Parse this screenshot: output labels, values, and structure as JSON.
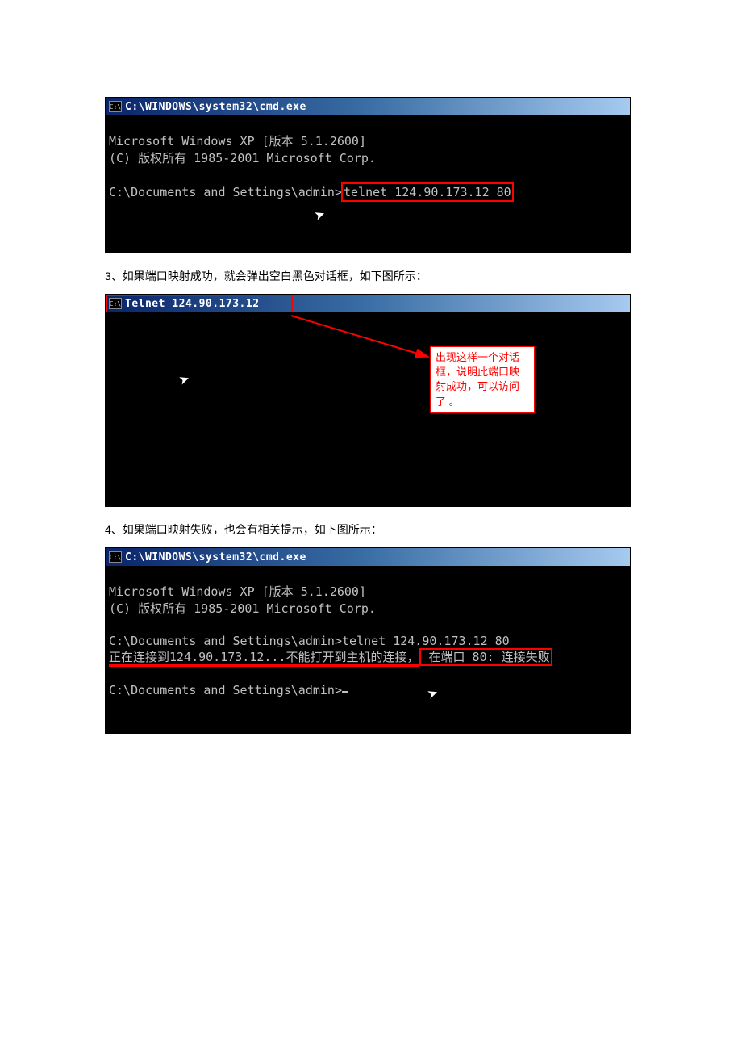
{
  "screenshot1": {
    "title": "C:\\WINDOWS\\system32\\cmd.exe",
    "icon_text": "C:\\",
    "line1": "Microsoft Windows XP [版本 5.1.2600]",
    "line2": "(C) 版权所有 1985-2001 Microsoft Corp.",
    "prompt": "C:\\Documents and Settings\\admin>",
    "command": "telnet 124.90.173.12 80"
  },
  "caption3": "3、如果端口映射成功，就会弹出空白黑色对话框，如下图所示：",
  "screenshot2": {
    "title": "Telnet 124.90.173.12",
    "icon_text": "C:\\",
    "callout_text": "出现这样一个对话框，说明此端口映射成功，可以访问了 。"
  },
  "caption4": "4、如果端口映射失败，也会有相关提示，如下图所示：",
  "screenshot3": {
    "title": "C:\\WINDOWS\\system32\\cmd.exe",
    "icon_text": "C:\\",
    "line1": "Microsoft Windows XP [版本 5.1.2600]",
    "line2": "(C) 版权所有 1985-2001 Microsoft Corp.",
    "prompt1": "C:\\Documents and Settings\\admin>",
    "command1": "telnet 124.90.173.12 80",
    "result_prefix": "正在连接到124.90.173.12...不能打开到主机的连接，",
    "result_boxed": " 在端口 80: 连接失败",
    "prompt2": "C:\\Documents and Settings\\admin>"
  }
}
